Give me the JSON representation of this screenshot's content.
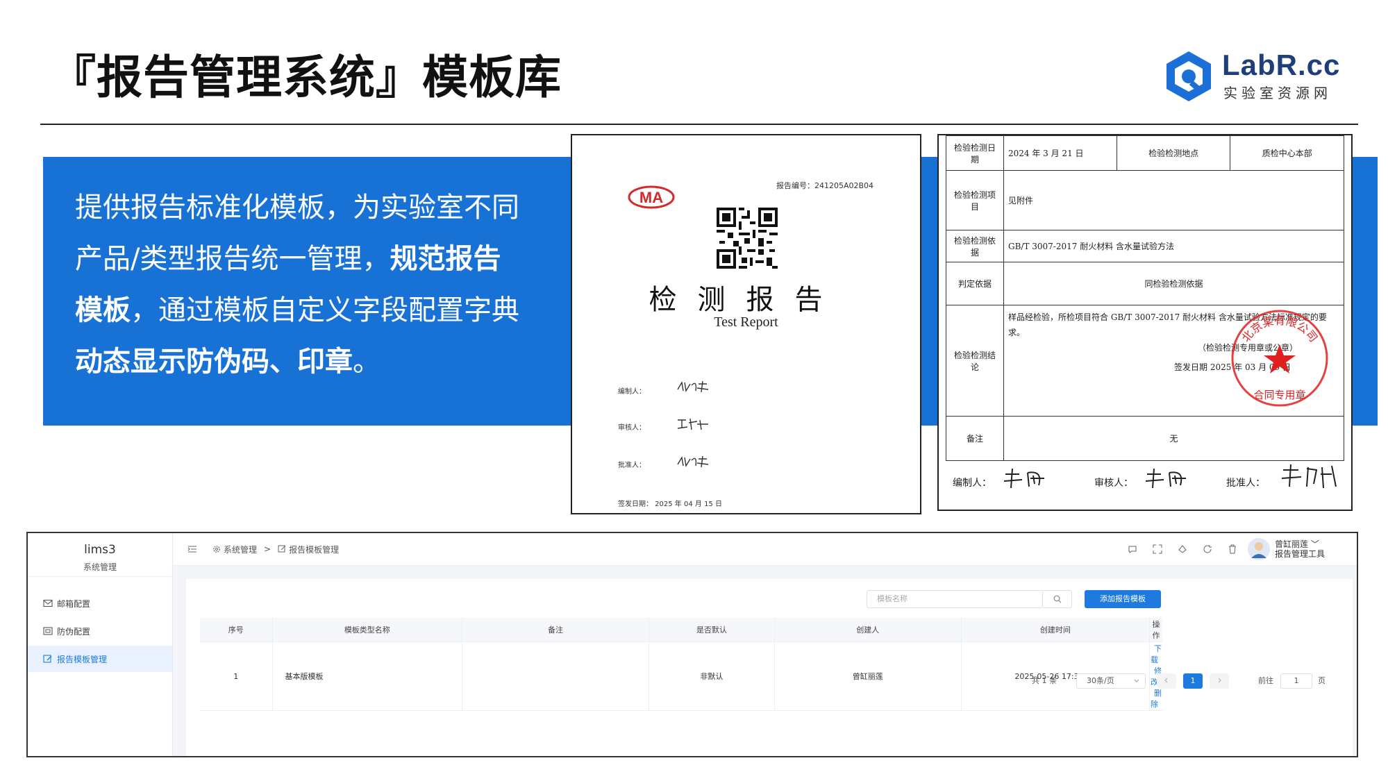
{
  "slide": {
    "title": "『报告管理系统』模板库",
    "logo_text": "LabR.cc",
    "logo_sub": "实验室资源网"
  },
  "band": {
    "text1": "提供报告标准化模板，为实验室不同产品/类型报告统一管理，",
    "bold1": "规范报告模板",
    "text2": "，通过模板自定义字段配置字典",
    "bold2": "动态显示防伪码、印章",
    "text3": "。"
  },
  "report1": {
    "ma": "MA",
    "report_no": "报告编号：241205A02B04",
    "title_cn": "检测报告",
    "title_en": "Test Report",
    "labels": [
      "编制人：",
      "审核人：",
      "批准人：",
      "签发日期：  2025 年 04 月 15 日"
    ]
  },
  "report2": {
    "rows": [
      [
        "检验检测日期",
        "2024 年 3 月 21 日",
        "检验检测地点",
        "质检中心本部"
      ],
      [
        "检验检测项目",
        "见附件"
      ],
      [
        "检验检测依据",
        "GB/T 3007-2017 耐火材料  含水量试验方法"
      ],
      [
        "判定依据",
        "同检验检测依据"
      ],
      [
        "检验检测结论",
        "样品经检验，所检项目符合 GB/T 3007-2017 耐火材料  含水量试验方法标准规定的要求。",
        "（检验检测专用章或公章）",
        "签发日期   2025 年 03 月 09 日"
      ],
      [
        "备注",
        "无"
      ]
    ],
    "footer": [
      "编制人：",
      "审核人：",
      "批准人："
    ],
    "seal_top": "北京某有限公司",
    "seal_bottom": "合同专用章"
  },
  "app": {
    "brand": "lims3",
    "brand_sub": "系统管理",
    "menu": [
      "邮箱配置",
      "防伪配置",
      "报告模板管理"
    ],
    "breadcrumb": [
      "系统管理",
      ">",
      "报告模板管理"
    ],
    "user_name": "曾缸丽莲 ﹀",
    "user_role": "报告管理工具",
    "search_placeholder": "模板名称",
    "add_button": "添加报告模板",
    "columns": [
      "序号",
      "模板类型名称",
      "备注",
      "是否默认",
      "创建人",
      "创建时间",
      "操作"
    ],
    "rows": [
      {
        "no": "1",
        "name": "基本版模板",
        "remark": "",
        "default": "非默认",
        "creator": "曾缸丽莲",
        "time": "2025-05-26 17:37:36"
      }
    ],
    "ops": [
      "下载",
      "修改",
      "删除"
    ],
    "pager": {
      "total": "共 1 条",
      "size": "30条/页",
      "page": "1",
      "goto": "前往",
      "goto_val": "1",
      "unit": "页"
    }
  }
}
